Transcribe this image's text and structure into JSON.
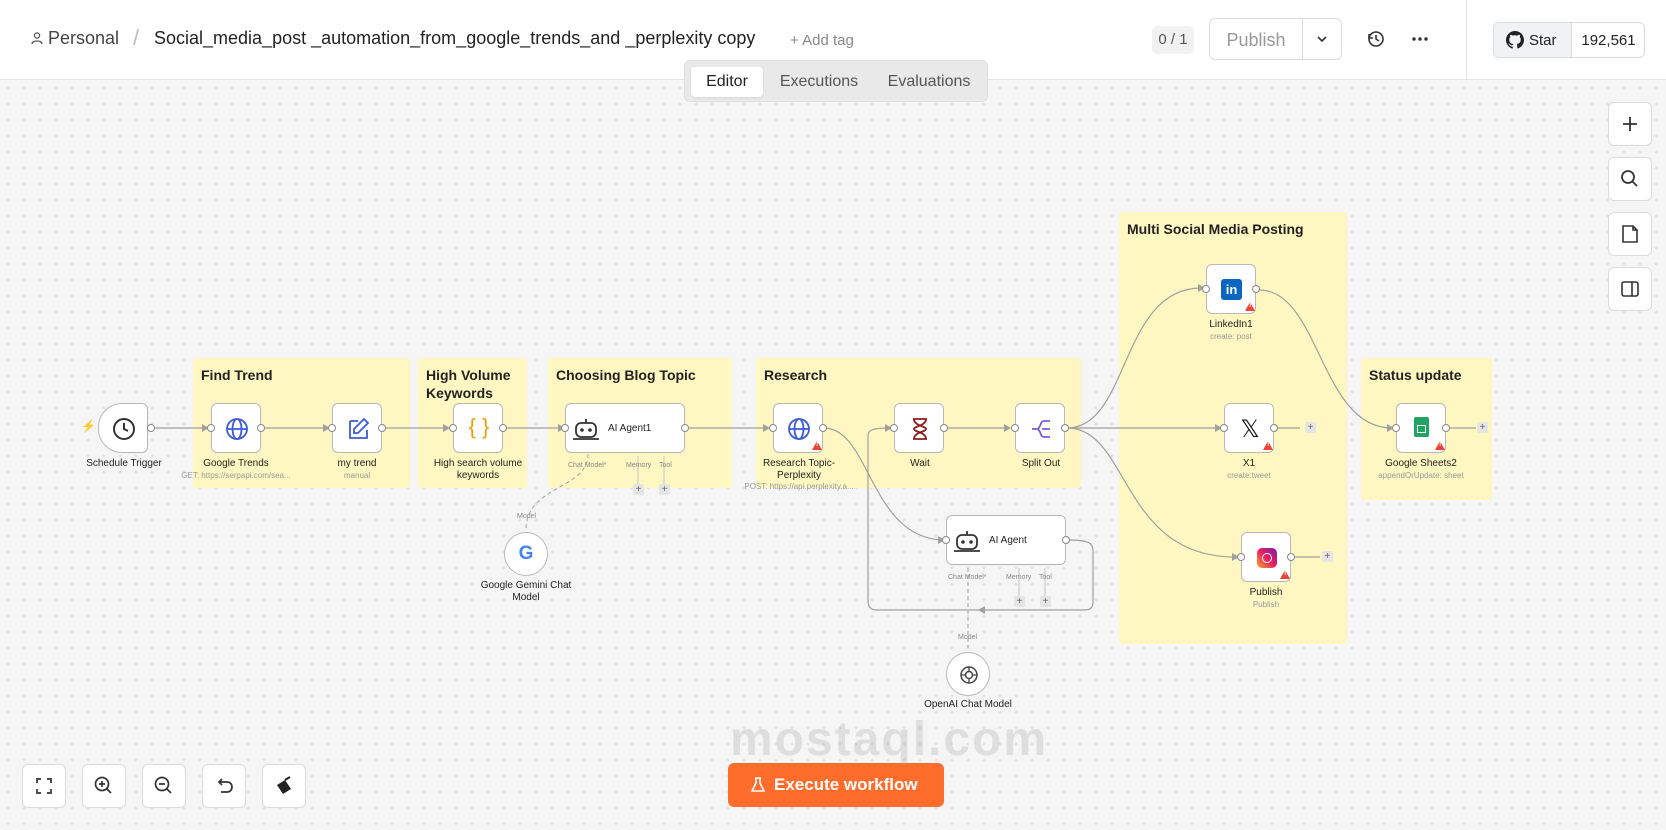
{
  "header": {
    "project": "Personal",
    "workflow_name": "Social_media_post _automation_from_google_trends_and _perplexity copy",
    "add_tag": "+ Add tag",
    "version_counter": "0 / 1",
    "publish_label": "Publish",
    "github_star": "Star",
    "github_count": "192,561"
  },
  "tabs": [
    {
      "label": "Editor",
      "active": true
    },
    {
      "label": "Executions",
      "active": false
    },
    {
      "label": "Evaluations",
      "active": false
    }
  ],
  "stickies": {
    "find_trend": "Find Trend",
    "high_volume_1": "High Volume",
    "high_volume_2": "Keywords",
    "choosing": "Choosing Blog Topic",
    "research": "Research",
    "multi_social": "Multi Social Media Posting",
    "status": "Status update"
  },
  "nodes": {
    "schedule": {
      "label": "Schedule Trigger"
    },
    "google_trends": {
      "label": "Google Trends",
      "sub": "GET: https://serpapi.com/sea..."
    },
    "my_trend": {
      "label": "my trend",
      "sub": "manual"
    },
    "high_search_1": "High search volume",
    "high_search_2": "keywords",
    "ai_agent1": {
      "label": "AI Agent1"
    },
    "gemini_1": "Google Gemini Chat",
    "gemini_2": "Model",
    "research_1": "Research Topic-",
    "research_2": "Perplexity",
    "research_sub": "POST: https://api.perplexity.a...",
    "wait": {
      "label": "Wait"
    },
    "split_out": {
      "label": "Split Out"
    },
    "ai_agent": {
      "label": "AI Agent"
    },
    "openai": {
      "label": "OpenAI Chat Model"
    },
    "linkedin": {
      "label": "LinkedIn1",
      "sub": "create: post"
    },
    "x1": {
      "label": "X1",
      "sub": "create:tweet"
    },
    "instagram": {
      "label": "Publish",
      "sub": "Publish"
    },
    "sheets": {
      "label": "Google Sheets2",
      "sub": "appendOrUpdate: sheet"
    }
  },
  "handles": {
    "chat_model": "Chat Model*",
    "memory": "Memory",
    "tool": "Tool",
    "model": "Model"
  },
  "footer": {
    "execute_label": "Execute workflow",
    "watermark": "mostaql.com"
  },
  "colors": {
    "accent": "#ff6d2d",
    "sticky": "#fff7c2",
    "warning": "#e43333"
  },
  "icons": [
    "user-icon",
    "chevron-down-icon",
    "history-icon",
    "more-icon",
    "github-icon",
    "plus-icon",
    "search-icon",
    "sticky-note-icon",
    "panel-icon",
    "fit-view-icon",
    "zoom-in-icon",
    "zoom-out-icon",
    "undo-icon",
    "clear-icon",
    "flask-icon"
  ]
}
